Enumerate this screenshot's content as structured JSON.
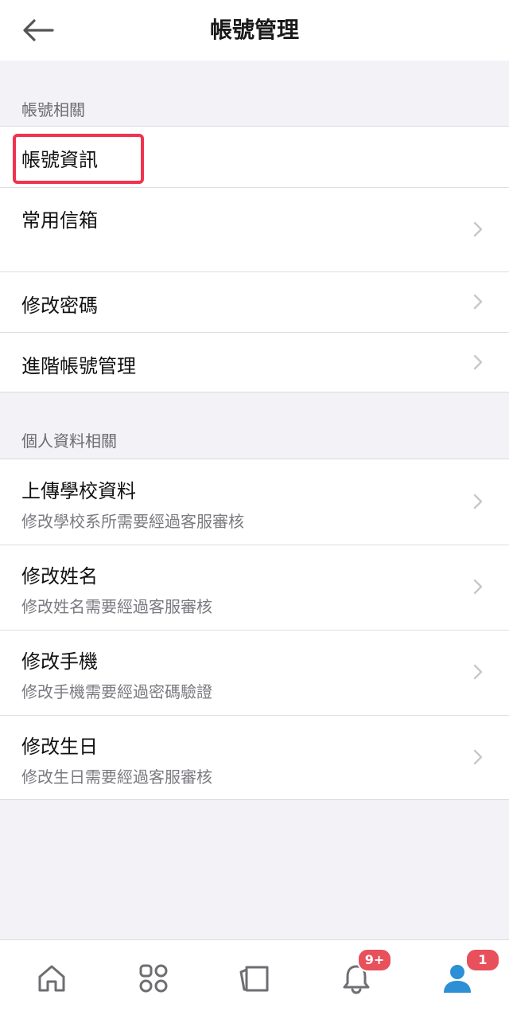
{
  "header": {
    "title": "帳號管理",
    "back_icon": "arrow-left-icon"
  },
  "sections": [
    {
      "title": "帳號相關",
      "items": [
        {
          "label": "帳號資訊",
          "chevron": false,
          "highlighted": true
        },
        {
          "label": "常用信箱",
          "chevron": true
        },
        {
          "label": "修改密碼",
          "chevron": true
        },
        {
          "label": "進階帳號管理",
          "chevron": true
        }
      ]
    },
    {
      "title": "個人資料相關",
      "items": [
        {
          "label": "上傳學校資料",
          "sublabel": "修改學校系所需要經過客服審核",
          "chevron": true
        },
        {
          "label": "修改姓名",
          "sublabel": "修改姓名需要經過客服審核",
          "chevron": true
        },
        {
          "label": "修改手機",
          "sublabel": "修改手機需要經過密碼驗證",
          "chevron": true
        },
        {
          "label": "修改生日",
          "sublabel": "修改生日需要經過客服審核",
          "chevron": true
        }
      ]
    }
  ],
  "tabbar": {
    "tabs": [
      {
        "icon": "home-icon"
      },
      {
        "icon": "grid-icon"
      },
      {
        "icon": "cards-icon"
      },
      {
        "icon": "bell-icon",
        "badge": "9+"
      },
      {
        "icon": "user-icon",
        "badge": "1",
        "active": true
      }
    ]
  },
  "colors": {
    "background": "#f2f2f7",
    "highlight": "#f0334f",
    "badge": "#e8505b",
    "active_tab": "#2d8fd5",
    "inactive_tab": "#6e6e73"
  }
}
